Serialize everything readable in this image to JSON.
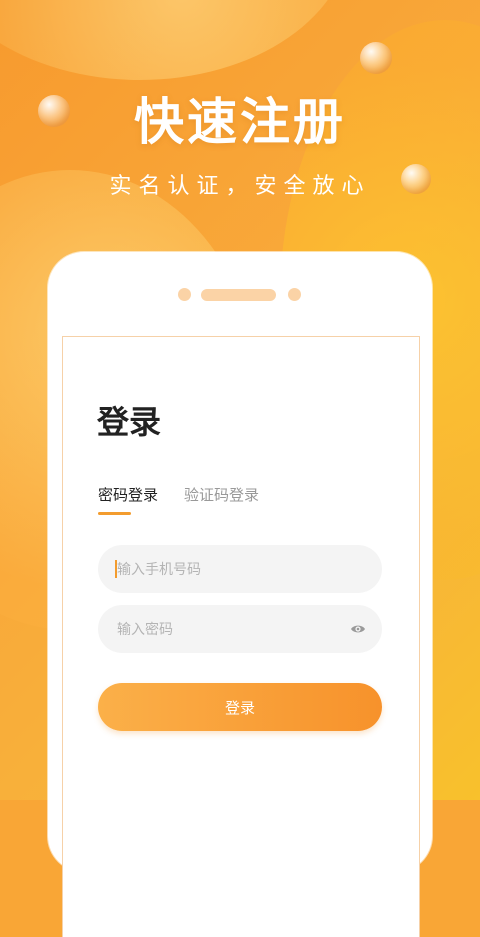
{
  "hero": {
    "title": "快速注册",
    "subtitle": "实名认证，安全放心"
  },
  "login": {
    "title": "登录",
    "tabs": [
      {
        "label": "密码登录",
        "active": true
      },
      {
        "label": "验证码登录",
        "active": false
      }
    ],
    "phone_placeholder": "输入手机号码",
    "password_placeholder": "输入密码",
    "submit_label": "登录"
  },
  "icons": {
    "password_toggle": "eye-icon"
  },
  "colors": {
    "accent": "#F39C2E",
    "button_gradient_start": "#FBB049",
    "button_gradient_end": "#F7922B",
    "background": "#F9A636"
  }
}
